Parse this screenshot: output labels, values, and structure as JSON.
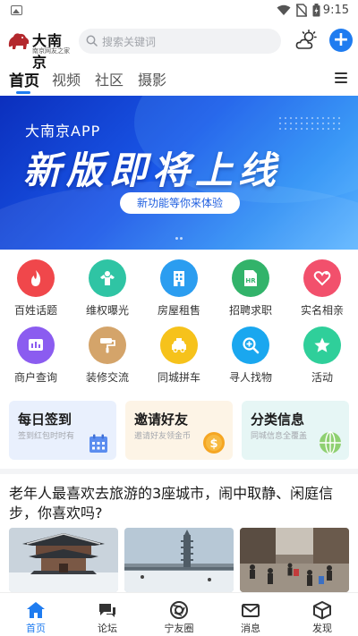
{
  "status_bar": {
    "time": "9:15",
    "icons": [
      "gallery-icon",
      "wifi-icon",
      "no-sim-icon",
      "battery-charging-icon"
    ]
  },
  "header": {
    "logo": {
      "brand": "大南京",
      "tagline": "南京网友之家"
    },
    "search": {
      "placeholder": "搜索关键词"
    },
    "weather_icon": "weather-icon",
    "add_icon": "plus-icon",
    "accent": "#1f7cf0"
  },
  "tabs": {
    "items": [
      {
        "label": "首页",
        "active": true
      },
      {
        "label": "视频",
        "active": false
      },
      {
        "label": "社区",
        "active": false
      },
      {
        "label": "摄影",
        "active": false
      }
    ],
    "menu_icon": "menu-icon"
  },
  "banner": {
    "app_name": "大南京APP",
    "headline": "新版即将上线",
    "cta": "新功能等你来体验",
    "page_count": 2
  },
  "grid": [
    {
      "label": "百姓话题",
      "color": "#f0474b",
      "icon": "flame-icon"
    },
    {
      "label": "维权曝光",
      "color": "#2fc4a4",
      "icon": "strongman-icon"
    },
    {
      "label": "房屋租售",
      "color": "#2b9df0",
      "icon": "building-icon"
    },
    {
      "label": "招聘求职",
      "color": "#32b36a",
      "icon": "hr-icon"
    },
    {
      "label": "实名相亲",
      "color": "#f2506c",
      "icon": "heart-icon"
    },
    {
      "label": "商户查询",
      "color": "#8b5cf0",
      "icon": "shop-icon"
    },
    {
      "label": "装修交流",
      "color": "#d4a46a",
      "icon": "paint-roller-icon"
    },
    {
      "label": "同城拼车",
      "color": "#f6c21b",
      "icon": "taxi-icon"
    },
    {
      "label": "寻人找物",
      "color": "#1aa7ef",
      "icon": "magnifier-icon"
    },
    {
      "label": "活动",
      "color": "#2fcf9a",
      "icon": "star-icon"
    }
  ],
  "cards": [
    {
      "title": "每日签到",
      "subtitle": "签到红包时时有",
      "bg": "#e9f0fd",
      "icon": "calendar-icon"
    },
    {
      "title": "邀请好友",
      "subtitle": "邀请好友领金币",
      "bg": "#fdf4e6",
      "icon": "coin-icon"
    },
    {
      "title": "分类信息",
      "subtitle": "同城信息全覆盖",
      "bg": "#e6f6f5",
      "icon": "globe-icon"
    }
  ],
  "article": {
    "title": "老年人最喜欢去旅游的3座城市，闹中取静、闲庭信步，你喜欢吗?",
    "thumbnails": [
      "pavilion-in-snow",
      "pagoda-in-snow",
      "crowded-street"
    ]
  },
  "bottom_nav": [
    {
      "label": "首页",
      "icon": "home-icon",
      "active": true
    },
    {
      "label": "论坛",
      "icon": "chat-icon",
      "active": false
    },
    {
      "label": "宁友圈",
      "icon": "camera-circle-icon",
      "active": false
    },
    {
      "label": "消息",
      "icon": "mail-icon",
      "active": false
    },
    {
      "label": "发现",
      "icon": "cube-icon",
      "active": false
    }
  ]
}
